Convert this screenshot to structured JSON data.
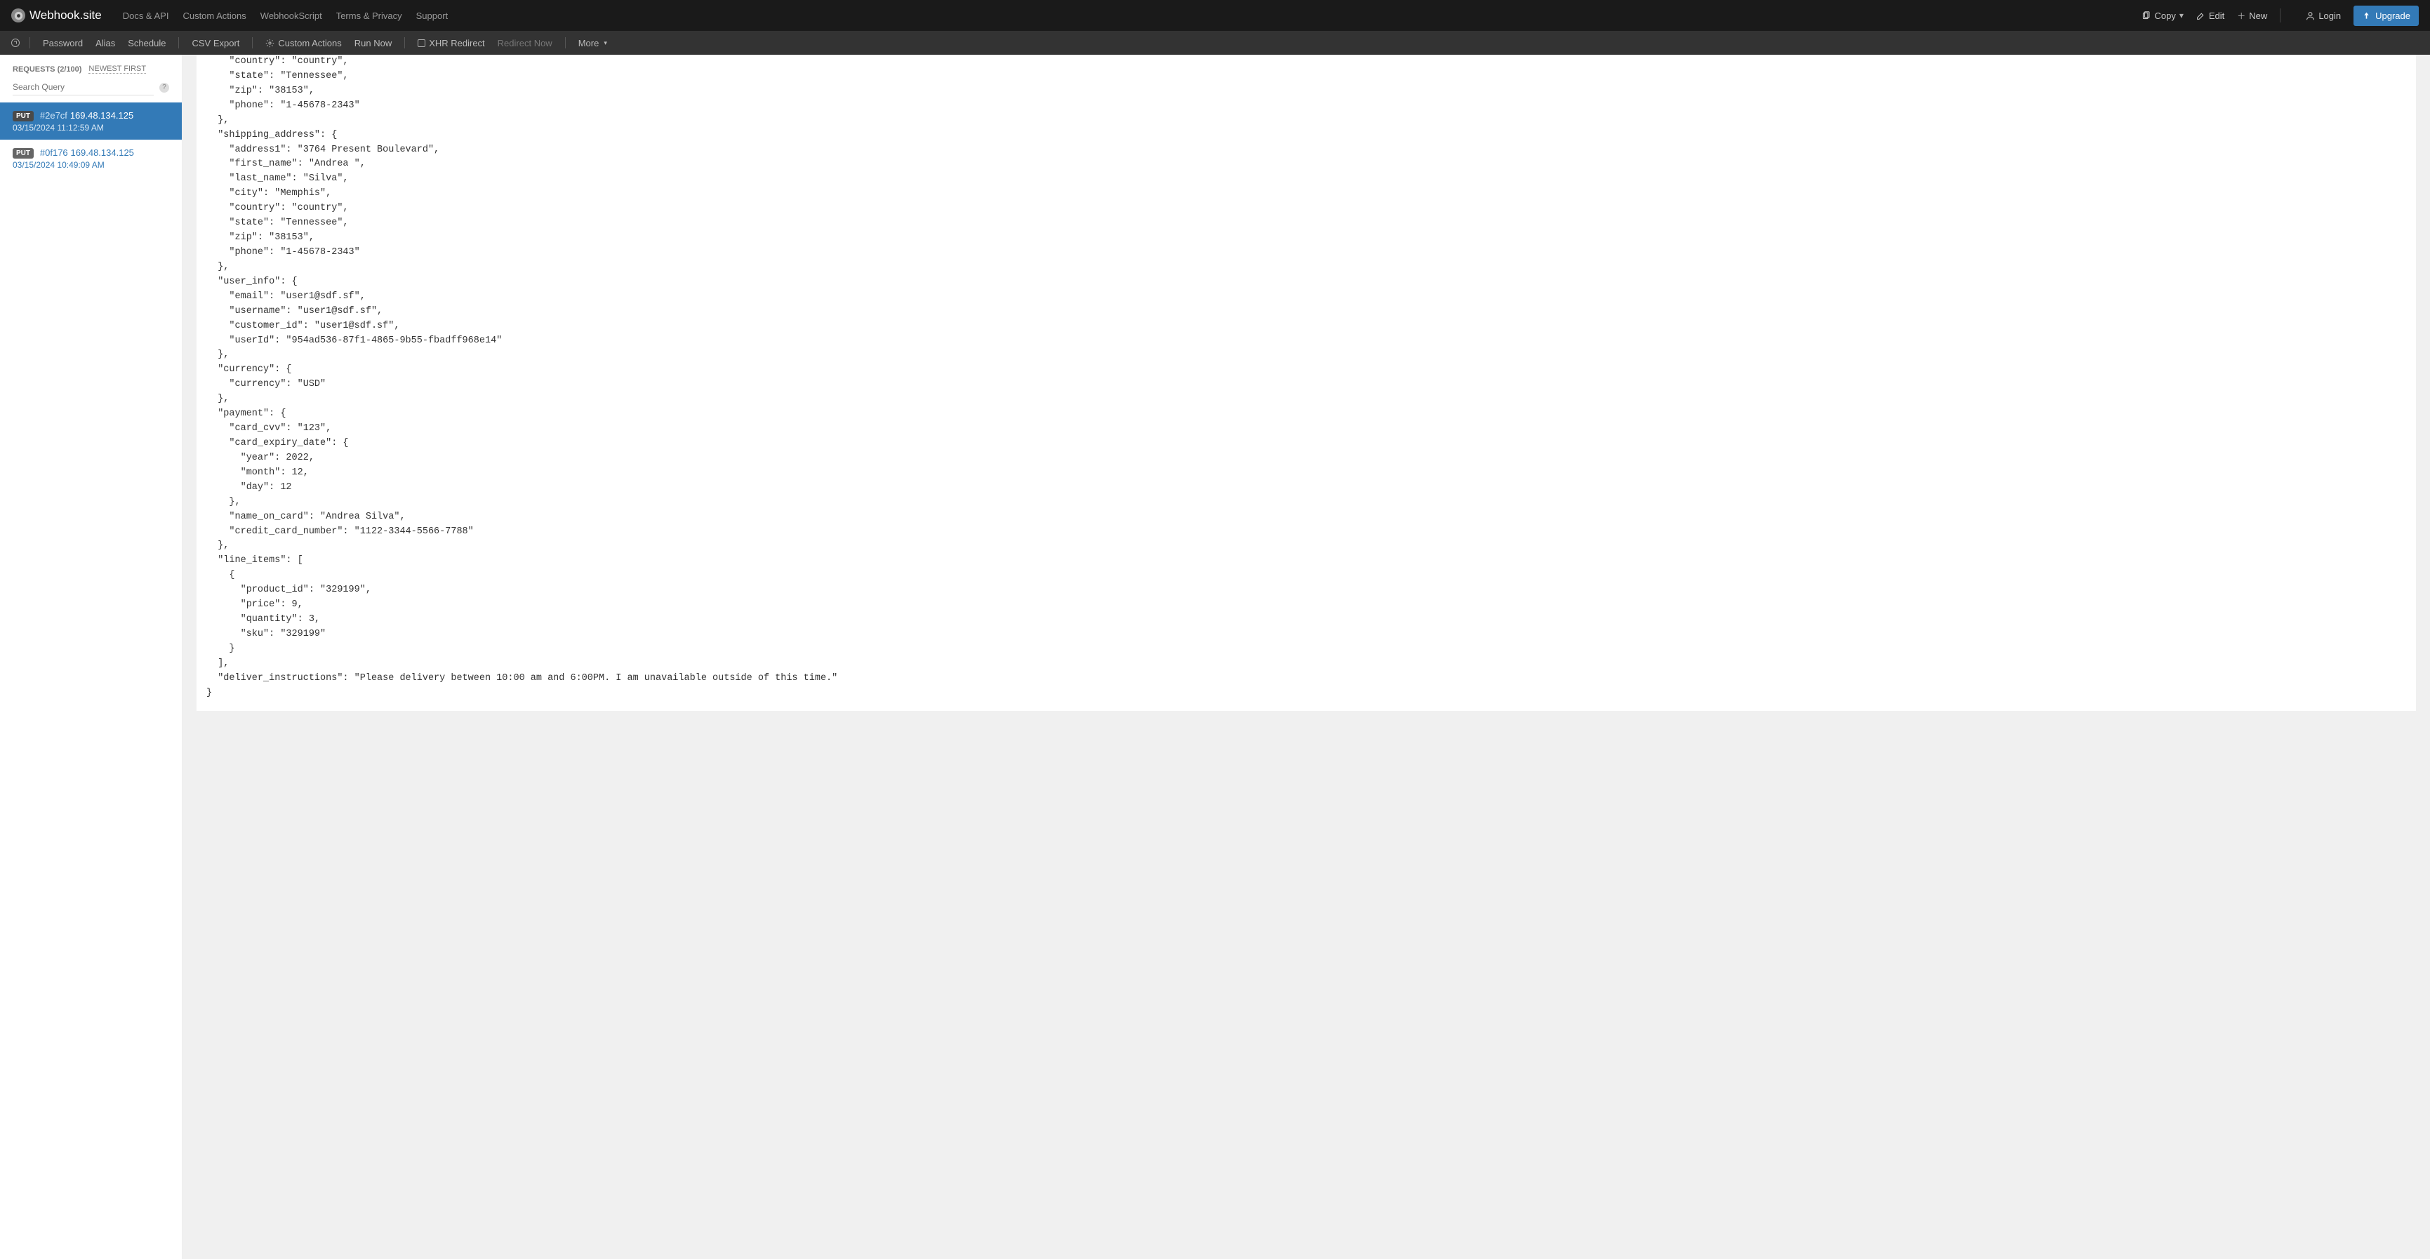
{
  "brand": "Webhook.site",
  "topnav_links": [
    "Docs & API",
    "Custom Actions",
    "WebhookScript",
    "Terms & Privacy",
    "Support"
  ],
  "topnav_right": {
    "copy": "Copy",
    "edit": "Edit",
    "new": "New",
    "login": "Login",
    "upgrade": "Upgrade"
  },
  "subnav": {
    "password": "Password",
    "alias": "Alias",
    "schedule": "Schedule",
    "csv_export": "CSV Export",
    "custom_actions": "Custom Actions",
    "run_now": "Run Now",
    "xhr_redirect": "XHR Redirect",
    "redirect_now": "Redirect Now",
    "more": "More"
  },
  "sidebar": {
    "requests_label": "REQUESTS (2/100)",
    "sort_label": "Newest First",
    "search_placeholder": "Search Query",
    "items": [
      {
        "method": "PUT",
        "hash": "#2e7cf",
        "ip": "169.48.134.125",
        "timestamp": "03/15/2024 11:12:59 AM",
        "active": true
      },
      {
        "method": "PUT",
        "hash": "#0f176",
        "ip": "169.48.134.125",
        "timestamp": "03/15/2024 10:49:09 AM",
        "active": false
      }
    ]
  },
  "code": "    \"country\": \"country\",\n    \"state\": \"Tennessee\",\n    \"zip\": \"38153\",\n    \"phone\": \"1-45678-2343\"\n  },\n  \"shipping_address\": {\n    \"address1\": \"3764 Present Boulevard\",\n    \"first_name\": \"Andrea \",\n    \"last_name\": \"Silva\",\n    \"city\": \"Memphis\",\n    \"country\": \"country\",\n    \"state\": \"Tennessee\",\n    \"zip\": \"38153\",\n    \"phone\": \"1-45678-2343\"\n  },\n  \"user_info\": {\n    \"email\": \"user1@sdf.sf\",\n    \"username\": \"user1@sdf.sf\",\n    \"customer_id\": \"user1@sdf.sf\",\n    \"userId\": \"954ad536-87f1-4865-9b55-fbadff968e14\"\n  },\n  \"currency\": {\n    \"currency\": \"USD\"\n  },\n  \"payment\": {\n    \"card_cvv\": \"123\",\n    \"card_expiry_date\": {\n      \"year\": 2022,\n      \"month\": 12,\n      \"day\": 12\n    },\n    \"name_on_card\": \"Andrea Silva\",\n    \"credit_card_number\": \"1122-3344-5566-7788\"\n  },\n  \"line_items\": [\n    {\n      \"product_id\": \"329199\",\n      \"price\": 9,\n      \"quantity\": 3,\n      \"sku\": \"329199\"\n    }\n  ],\n  \"deliver_instructions\": \"Please delivery between 10:00 am and 6:00PM. I am unavailable outside of this time.\"\n}"
}
